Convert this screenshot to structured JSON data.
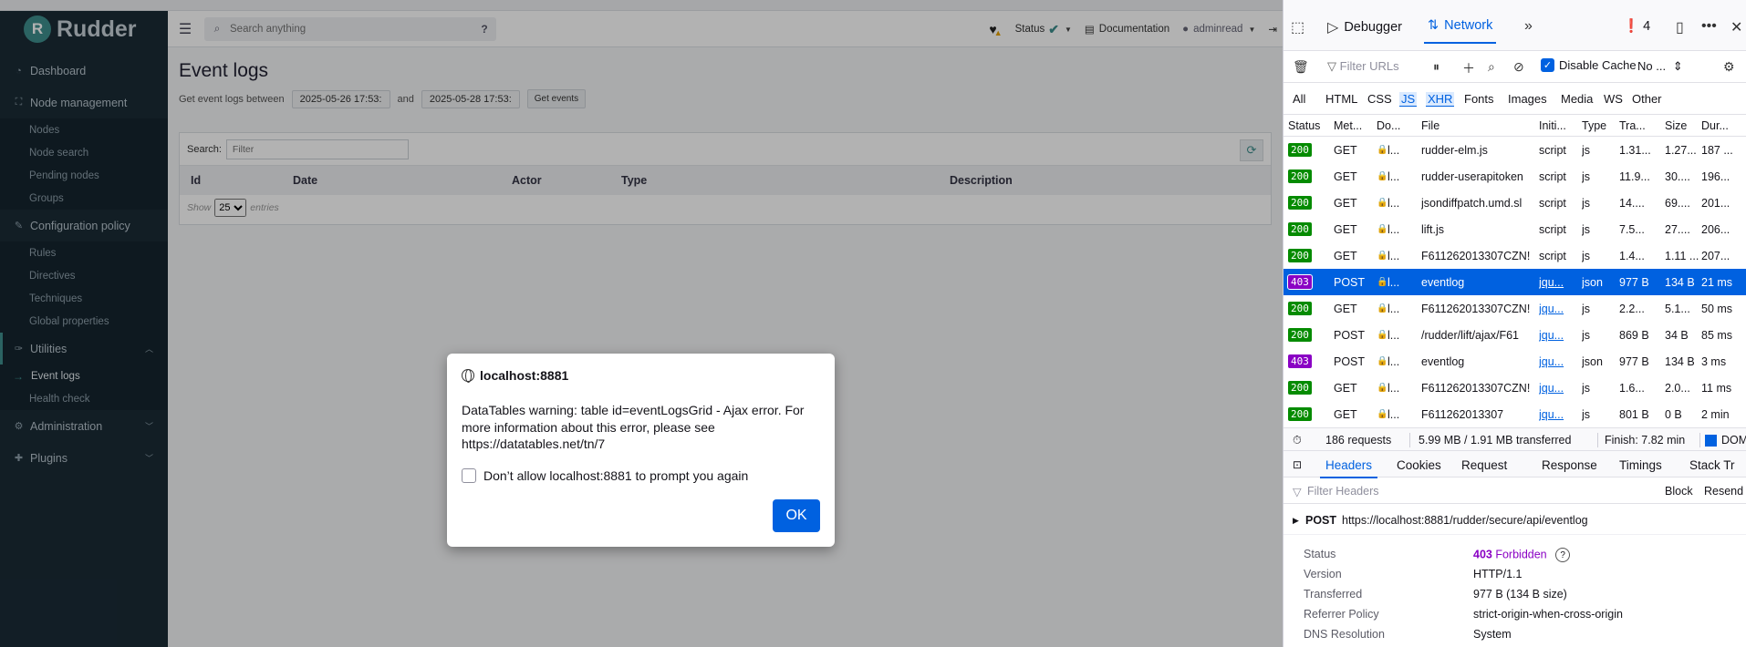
{
  "app": {
    "brand": "Rudder",
    "sidebar": {
      "items": [
        {
          "label": "Dashboard",
          "icon": "dashboard-icon"
        },
        {
          "label": "Node management",
          "icon": "sitemap-icon"
        },
        {
          "label": "Nodes"
        },
        {
          "label": "Node search"
        },
        {
          "label": "Pending nodes"
        },
        {
          "label": "Groups"
        },
        {
          "label": "Configuration policy",
          "icon": "pencil-icon"
        },
        {
          "label": "Rules"
        },
        {
          "label": "Directives"
        },
        {
          "label": "Techniques"
        },
        {
          "label": "Global properties"
        },
        {
          "label": "Utilities",
          "icon": "wrench-icon"
        },
        {
          "label": "Event logs"
        },
        {
          "label": "Health check"
        },
        {
          "label": "Administration",
          "icon": "gear-icon"
        },
        {
          "label": "Plugins",
          "icon": "puzzle-icon"
        }
      ]
    },
    "topbar": {
      "search_placeholder": "Search anything",
      "status_label": "Status",
      "documentation_label": "Documentation",
      "user_label": "adminread"
    },
    "page": {
      "title": "Event logs",
      "filter_prefix": "Get event logs between",
      "date_from": "2025-05-26 17:53:",
      "and_label": "and",
      "date_to": "2025-05-28 17:53:",
      "get_events_label": "Get events",
      "search_label": "Search:",
      "search_placeholder": "Filter",
      "columns": [
        "Id",
        "Date",
        "Actor",
        "Type",
        "Description"
      ],
      "show_label": "Show",
      "page_size": "25",
      "entries_label": "entries"
    },
    "dialog": {
      "host": "localhost:8881",
      "message": "DataTables warning: table id=eventLogsGrid - Ajax error. For more information about this error, please see https://datatables.net/tn/7",
      "checkbox_label": "Don’t allow localhost:8881 to prompt you again",
      "ok_label": "OK"
    }
  },
  "devtools": {
    "tabs": {
      "debugger": "Debugger",
      "network": "Network"
    },
    "error_count": "4",
    "filter_urls_placeholder": "Filter URLs",
    "disable_cache_label": "Disable Cache",
    "throttle_label": "No ...",
    "type_filters": [
      "All",
      "HTML",
      "CSS",
      "JS",
      "XHR",
      "Fonts",
      "Images",
      "Media",
      "WS",
      "Other"
    ],
    "columns": [
      "Status",
      "Met...",
      "Do...",
      "File",
      "Initi...",
      "Type",
      "Tra...",
      "Size",
      "Dur..."
    ],
    "requests": [
      {
        "status": "200",
        "method": "GET",
        "domain": "l...",
        "file": "rudder-elm.js",
        "initiator": "script",
        "type": "js",
        "transferred": "1.31...",
        "size": "1.27...",
        "duration": "187 ..."
      },
      {
        "status": "200",
        "method": "GET",
        "domain": "l...",
        "file": "rudder-userapitoken",
        "initiator": "script",
        "type": "js",
        "transferred": "11.9...",
        "size": "30....",
        "duration": "196..."
      },
      {
        "status": "200",
        "method": "GET",
        "domain": "l...",
        "file": "jsondiffpatch.umd.sl",
        "initiator": "script",
        "type": "js",
        "transferred": "14....",
        "size": "69....",
        "duration": "201..."
      },
      {
        "status": "200",
        "method": "GET",
        "domain": "l...",
        "file": "lift.js",
        "initiator": "script",
        "type": "js",
        "transferred": "7.5...",
        "size": "27....",
        "duration": "206..."
      },
      {
        "status": "200",
        "method": "GET",
        "domain": "l...",
        "file": "F611262013307CZN!",
        "initiator": "script",
        "type": "js",
        "transferred": "1.4...",
        "size": "1.11 ...",
        "duration": "207..."
      },
      {
        "status": "403",
        "method": "POST",
        "domain": "l...",
        "file": "eventlog",
        "initiator": "jqu...",
        "type": "json",
        "transferred": "977 B",
        "size": "134 B",
        "duration": "21 ms"
      },
      {
        "status": "200",
        "method": "GET",
        "domain": "l...",
        "file": "F611262013307CZN!",
        "initiator": "jqu...",
        "type": "js",
        "transferred": "2.2...",
        "size": "5.1...",
        "duration": "50 ms"
      },
      {
        "status": "200",
        "method": "POST",
        "domain": "l...",
        "file": "/rudder/lift/ajax/F61",
        "initiator": "jqu...",
        "type": "js",
        "transferred": "869 B",
        "size": "34 B",
        "duration": "85 ms"
      },
      {
        "status": "403",
        "method": "POST",
        "domain": "l...",
        "file": "eventlog",
        "initiator": "jqu...",
        "type": "json",
        "transferred": "977 B",
        "size": "134 B",
        "duration": "3 ms"
      },
      {
        "status": "200",
        "method": "GET",
        "domain": "l...",
        "file": "F611262013307CZN!",
        "initiator": "jqu...",
        "type": "js",
        "transferred": "1.6...",
        "size": "2.0...",
        "duration": "11 ms"
      },
      {
        "status": "200",
        "method": "GET",
        "domain": "l...",
        "file": "F611262013307",
        "initiator": "jqu...",
        "type": "js",
        "transferred": "801 B",
        "size": "0 B",
        "duration": "2 min"
      }
    ],
    "summary": {
      "requests": "186 requests",
      "transferred": "5.99 MB / 1.91 MB transferred",
      "finish": "Finish: 7.82 min",
      "dom": "DOM"
    },
    "detail_tabs": [
      "Headers",
      "Cookies",
      "Request",
      "Response",
      "Timings",
      "Stack Tr"
    ],
    "filter_headers_placeholder": "Filter Headers",
    "block_label": "Block",
    "resend_label": "Resend",
    "request_method": "POST",
    "request_url": "https://localhost:8881/rudder/secure/api/eventlog",
    "details": {
      "status_key": "Status",
      "status_code": "403",
      "status_text": "Forbidden",
      "version_key": "Version",
      "version": "HTTP/1.1",
      "transferred_key": "Transferred",
      "transferred": "977 B (134 B size)",
      "referrer_key": "Referrer Policy",
      "referrer": "strict-origin-when-cross-origin",
      "dns_key": "DNS Resolution",
      "dns": "System"
    }
  }
}
